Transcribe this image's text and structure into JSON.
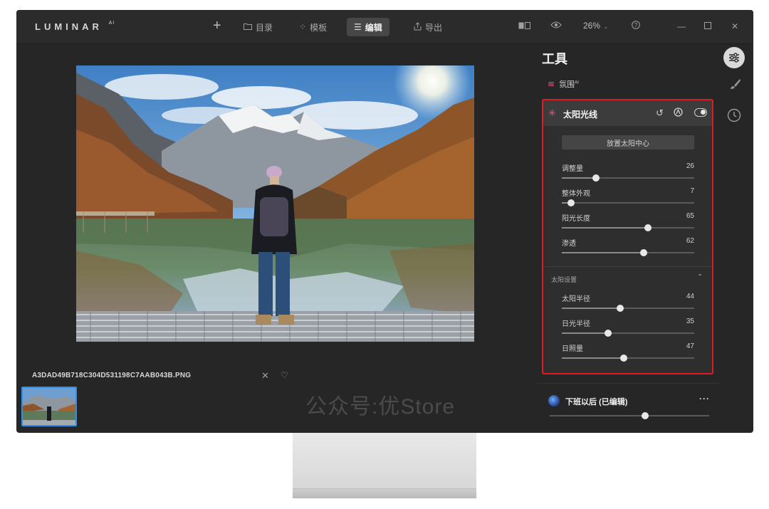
{
  "app": {
    "logo": "LUMINAR",
    "logo_sup": "AI"
  },
  "nav": {
    "add": "+",
    "catalog": "目录",
    "templates": "模板",
    "edit": "编辑",
    "export": "导出"
  },
  "toolbar": {
    "zoom": "26%"
  },
  "panel": {
    "title": "工具",
    "atmosphere": "氛围",
    "atmosphere_sup": "AI",
    "sunrays": {
      "title": "太阳光线",
      "place_button": "放置太阳中心",
      "sliders": [
        {
          "label": "调整量",
          "value": "26"
        },
        {
          "label": "整体外观",
          "value": "7"
        },
        {
          "label": "阳光长度",
          "value": "65"
        },
        {
          "label": "渗透",
          "value": "62"
        }
      ],
      "section": "太阳设置",
      "section_sliders": [
        {
          "label": "太阳半径",
          "value": "44"
        },
        {
          "label": "日光半径",
          "value": "35"
        },
        {
          "label": "日照量",
          "value": "47"
        }
      ]
    },
    "preset": {
      "name": "下班以后 (已编辑)",
      "more": "···",
      "amount": 60
    }
  },
  "file": {
    "name": "A3DAD49B718C304D531198C7AAB043B.PNG"
  },
  "watermark": "公众号:优Store",
  "colors": {
    "accent_pink": "#e25b8e",
    "highlight_red": "#e01b24",
    "thumb_border": "#2f8ff0"
  }
}
